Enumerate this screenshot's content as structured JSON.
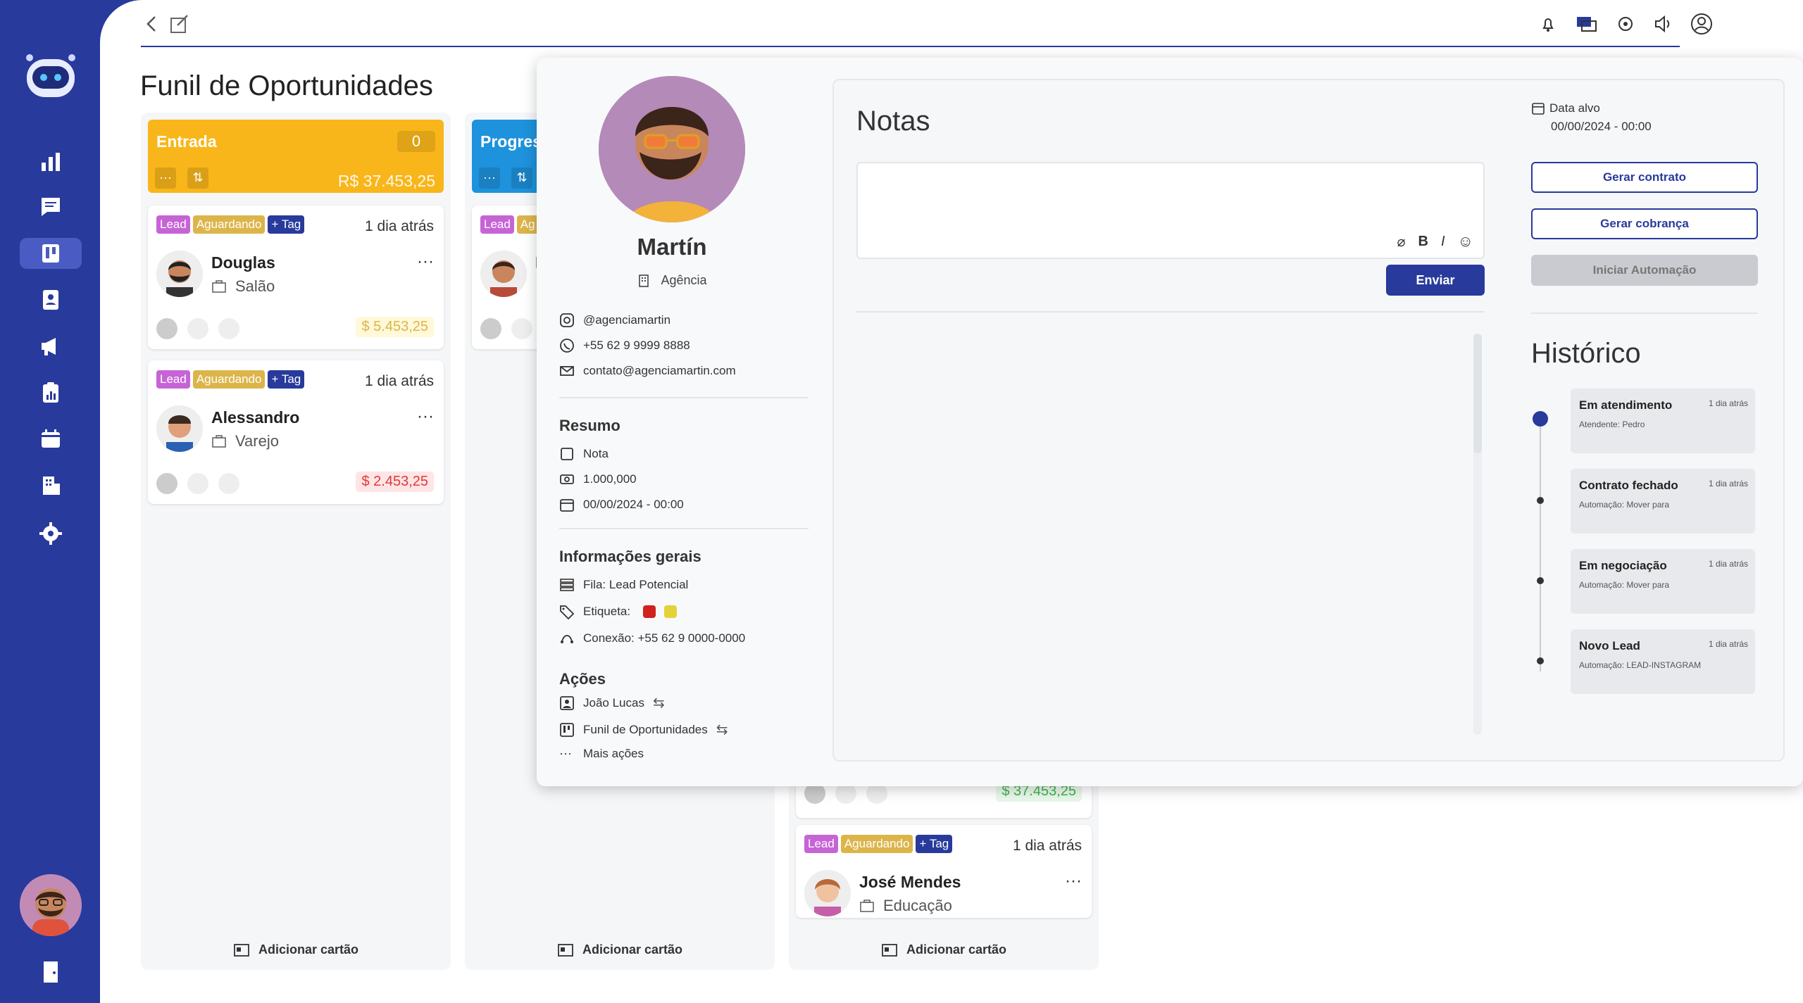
{
  "app": {
    "page_title": "Funil de Oportunidades"
  },
  "columns": [
    {
      "title": "Entrada",
      "count": "0",
      "total": "R$ 37.453,25",
      "color": "#f8b61a",
      "add_label": "Adicionar cartão",
      "cards": [
        {
          "tags": [
            "Lead",
            "Aguardando",
            "+ Tag"
          ],
          "time": "1 dia atrás",
          "name": "Douglas",
          "sector": "Salão",
          "price": "$ 5.453,25",
          "price_state": "yellow",
          "channel": "instagram"
        },
        {
          "tags": [
            "Lead",
            "Aguardando",
            "+ Tag"
          ],
          "time": "1 dia atrás",
          "name": "Alessandro",
          "sector": "Varejo",
          "price": "$ 2.453,25",
          "price_state": "red",
          "channel": "facebook"
        }
      ]
    },
    {
      "title": "Progres",
      "count": "",
      "total": "",
      "color": "#1e92dc",
      "add_label": "Adicionar cartão",
      "cards": [
        {
          "tags": [
            "Lead",
            "Ag"
          ],
          "time": "",
          "name": "I",
          "sector": "",
          "price": "",
          "channel": "whatsapp"
        }
      ]
    },
    {
      "title": "",
      "count": "",
      "total": "",
      "color": "",
      "add_label": "Adicionar cartão",
      "cards": [
        {
          "price": "$ 37.453,25",
          "price_state": "green"
        },
        {
          "tags": [
            "Lead",
            "Aguardando",
            "+ Tag"
          ],
          "time": "1 dia atrás",
          "name": "José Mendes",
          "sector": "Educação",
          "channel": "instagram"
        }
      ]
    }
  ],
  "contact": {
    "name": "Martín",
    "company": "Agência",
    "instagram": "@agenciamartin",
    "phone": "+55 62 9 9999 8888",
    "email": "contato@agenciamartin.com",
    "resumo_title": "Resumo",
    "resumo": {
      "nota": "Nota",
      "valor": "1.000,000",
      "data": "00/00/2024 - 00:00"
    },
    "info_title": "Informações gerais",
    "fila": "Fila: Lead Potencial",
    "etiqueta": "Etiqueta:",
    "conexao": "Conexão: +55 62 9 0000-0000",
    "acoes_title": "Ações",
    "acoes": {
      "responsavel": "João Lucas",
      "funil": "Funil de Oportunidades",
      "mais": "Mais ações"
    }
  },
  "notes": {
    "title": "Notas",
    "send_label": "Enviar",
    "bold": "B",
    "italic": "I"
  },
  "side": {
    "date_label": "Data alvo",
    "date_value": "00/00/2024 - 00:00",
    "gerar_contrato": "Gerar contrato",
    "gerar_cobranca": "Gerar cobrança",
    "iniciar_automacao": "Iniciar Automação",
    "historico_title": "Histórico",
    "historico": [
      {
        "title": "Em atendimento",
        "desc": "Atendente: Pedro",
        "time": "1 dia atrás"
      },
      {
        "title": "Contrato fechado",
        "desc": "Automação: Mover para",
        "time": "1 dia atrás"
      },
      {
        "title": "Em negociação",
        "desc": "Automação: Mover para",
        "time": "1 dia atrás"
      },
      {
        "title": "Novo Lead",
        "desc": "Automação: LEAD-INSTAGRAM",
        "time": "1 dia atrás"
      }
    ]
  },
  "colors": {
    "primary": "#283a9c",
    "entrada": "#f8b61a",
    "progresso": "#1e92dc",
    "tag_lead": "#c664d6",
    "tag_aguardando": "#dcb54a"
  }
}
